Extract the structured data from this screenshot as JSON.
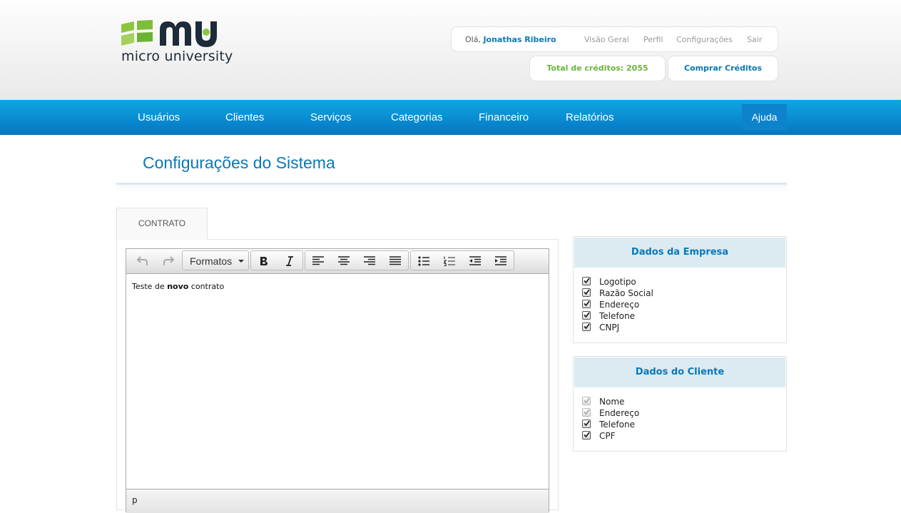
{
  "logo": {
    "text": "micro university"
  },
  "user": {
    "greeting_prefix": "Olá,",
    "name": "Jonathas Ribeiro",
    "links": [
      "Visão Geral",
      "Perfil",
      "Configurações",
      "Sair"
    ]
  },
  "credits": {
    "label": "Total de créditos: 2055",
    "buy_label": "Comprar Créditos"
  },
  "nav": {
    "items": [
      "Usuários",
      "Clientes",
      "Serviços",
      "Categorias",
      "Financeiro",
      "Relatórios"
    ],
    "help_label": "Ajuda"
  },
  "page": {
    "title": "Configurações do Sistema"
  },
  "tabs": {
    "active_label": "CONTRATO"
  },
  "editor": {
    "formats_label": "Formatos",
    "content_before": "Teste de ",
    "content_bold": "novo",
    "content_after": " contrato",
    "path": "p"
  },
  "empresa": {
    "title": "Dados da Empresa",
    "items": [
      {
        "label": "Logotipo",
        "checked": true,
        "disabled": false
      },
      {
        "label": "Razão Social",
        "checked": true,
        "disabled": false
      },
      {
        "label": "Endereço",
        "checked": true,
        "disabled": false
      },
      {
        "label": "Telefone",
        "checked": true,
        "disabled": false
      },
      {
        "label": "CNPJ",
        "checked": true,
        "disabled": false
      }
    ]
  },
  "cliente": {
    "title": "Dados do Cliente",
    "items": [
      {
        "label": "Nome",
        "checked": true,
        "disabled": true
      },
      {
        "label": "Endereço",
        "checked": true,
        "disabled": true
      },
      {
        "label": "Telefone",
        "checked": true,
        "disabled": false
      },
      {
        "label": "CPF",
        "checked": true,
        "disabled": false
      }
    ]
  },
  "colors": {
    "brand_blue": "#0a78b9",
    "credits_green": "#6cb43f",
    "nav_top": "#10a7e2",
    "nav_bottom": "#0577c3"
  }
}
